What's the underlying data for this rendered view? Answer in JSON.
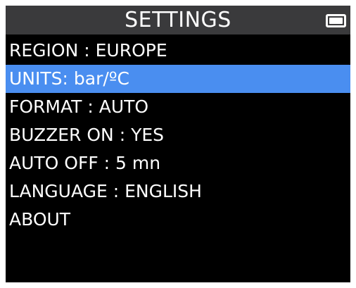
{
  "header": {
    "title": "SETTINGS",
    "battery_icon": "battery-full-icon"
  },
  "menu": {
    "selected_index": 1,
    "selection_color": "#4a8ef0",
    "items": [
      {
        "label": "REGION : EUROPE"
      },
      {
        "label": "UNITS: bar/ºC"
      },
      {
        "label": "FORMAT : AUTO"
      },
      {
        "label": "BUZZER ON : YES"
      },
      {
        "label": "AUTO OFF : 5 mn"
      },
      {
        "label": "LANGUAGE : ENGLISH"
      },
      {
        "label": "ABOUT"
      }
    ]
  }
}
